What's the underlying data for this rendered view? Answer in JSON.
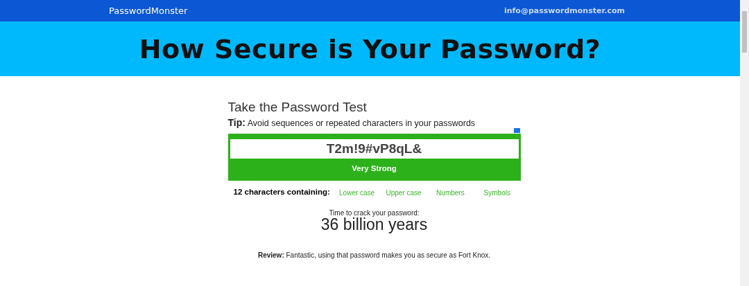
{
  "header": {
    "brand": "PasswordMonster",
    "email": "info@passwordmonster.com"
  },
  "banner": {
    "title": "How Secure is Your Password?"
  },
  "test": {
    "heading": "Take the Password Test",
    "tip": "**Tip:** Avoid sequences or repeated characters in your passwords",
    "show_password": {
      "checked": true
    },
    "password": "T2m!9#vP8qL&",
    "strength": "Very Strong"
  },
  "composition": {
    "label": "12 characters containing:",
    "criteria": [
      {
        "label": "Lower case",
        "met": true
      },
      {
        "label": "Upper case",
        "met": true
      },
      {
        "label": "Numbers",
        "met": true
      },
      {
        "label": "Symbols",
        "met": true
      }
    ]
  },
  "crack": {
    "label": "Time to crack your password:",
    "value": "36 billion years"
  },
  "review": "**Review:** Fantastic, using that password makes you as secure as Fort Knox."
}
